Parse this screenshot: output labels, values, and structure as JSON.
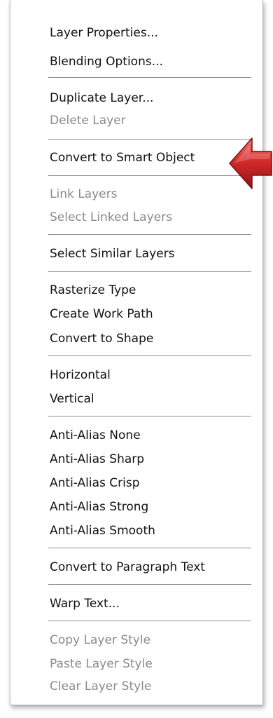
{
  "menu": {
    "groups": [
      {
        "items": [
          {
            "label": "Layer Properties...",
            "disabled": false
          },
          {
            "label": "Blending Options...",
            "disabled": false
          }
        ]
      },
      {
        "items": [
          {
            "label": "Duplicate Layer...",
            "disabled": false
          },
          {
            "label": "Delete Layer",
            "disabled": true
          }
        ]
      },
      {
        "items": [
          {
            "label": "Convert to Smart Object",
            "disabled": false
          }
        ]
      },
      {
        "items": [
          {
            "label": "Link Layers",
            "disabled": true
          },
          {
            "label": "Select Linked Layers",
            "disabled": true
          }
        ]
      },
      {
        "items": [
          {
            "label": "Select Similar Layers",
            "disabled": false
          }
        ]
      },
      {
        "items": [
          {
            "label": "Rasterize Type",
            "disabled": false
          },
          {
            "label": "Create Work Path",
            "disabled": false
          },
          {
            "label": "Convert to Shape",
            "disabled": false
          }
        ]
      },
      {
        "items": [
          {
            "label": "Horizontal",
            "disabled": false
          },
          {
            "label": "Vertical",
            "disabled": false
          }
        ]
      },
      {
        "items": [
          {
            "label": "Anti-Alias None",
            "disabled": false
          },
          {
            "label": "Anti-Alias Sharp",
            "disabled": false
          },
          {
            "label": "Anti-Alias Crisp",
            "disabled": false
          },
          {
            "label": "Anti-Alias Strong",
            "disabled": false
          },
          {
            "label": "Anti-Alias Smooth",
            "disabled": false
          }
        ]
      },
      {
        "items": [
          {
            "label": "Convert to Paragraph Text",
            "disabled": false
          }
        ]
      },
      {
        "items": [
          {
            "label": "Warp Text...",
            "disabled": false
          }
        ]
      },
      {
        "items": [
          {
            "label": "Copy Layer Style",
            "disabled": true
          },
          {
            "label": "Paste Layer Style",
            "disabled": true
          },
          {
            "label": "Clear Layer Style",
            "disabled": true
          }
        ]
      }
    ]
  },
  "annotation": {
    "icon": "red-arrow-icon",
    "color": "#d42a2a"
  }
}
